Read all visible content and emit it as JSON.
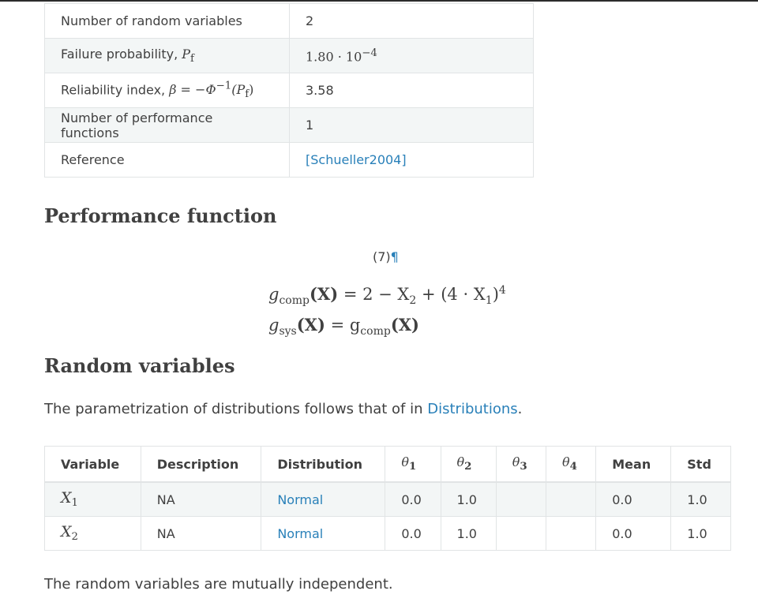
{
  "summary_table": [
    {
      "key": "Number of random variables",
      "value": "2"
    },
    {
      "key": "Failure probability, ",
      "key_math": "P",
      "key_math_sub": "f",
      "value_math": "1.80 · 10",
      "value_exp": "−4"
    },
    {
      "key": "Reliability index, ",
      "key_math": "β = −Φ",
      "key_math_sup": "−1",
      "key_math_tail": "(P",
      "key_math_sub": "f",
      "key_math_close": ")",
      "value": "3.58"
    },
    {
      "key": "Number of performance functions",
      "value": "1"
    },
    {
      "key": "Reference",
      "value_link": "[Schueller2004]"
    }
  ],
  "performance_heading": "Performance function",
  "equation_number": "(7)",
  "pilcrow": "¶",
  "equations": {
    "line1": {
      "g": "g",
      "sub": "comp",
      "lhs_arg": "(X)",
      "rhs_a": " = 2 − X",
      "x_sub_a": "2",
      "rhs_b": " + (4 · X",
      "x_sub_b": "1",
      "rhs_c": ")",
      "exp": "4"
    },
    "line2": {
      "g": "g",
      "sub": "sys",
      "lhs_arg": "(X)",
      "mid": " = g",
      "sub2": "comp",
      "rhs_arg": "(X)"
    }
  },
  "random_heading": "Random variables",
  "param_text": "The parametrization of distributions follows that of in ",
  "param_link": "Distributions",
  "param_end": ".",
  "variables_table": {
    "headers": [
      "Variable",
      "Description",
      "Distribution",
      "θ",
      "θ",
      "θ",
      "θ",
      "Mean",
      "Std"
    ],
    "theta_subs": [
      "1",
      "2",
      "3",
      "4"
    ],
    "rows": [
      {
        "var": "X",
        "var_sub": "1",
        "description": "NA",
        "distribution": "Normal",
        "t1": "0.0",
        "t2": "1.0",
        "t3": "",
        "t4": "",
        "mean": "0.0",
        "std": "1.0"
      },
      {
        "var": "X",
        "var_sub": "2",
        "description": "NA",
        "distribution": "Normal",
        "t1": "0.0",
        "t2": "1.0",
        "t3": "",
        "t4": "",
        "mean": "0.0",
        "std": "1.0"
      }
    ]
  },
  "independence_text": "The random variables are mutually independent."
}
